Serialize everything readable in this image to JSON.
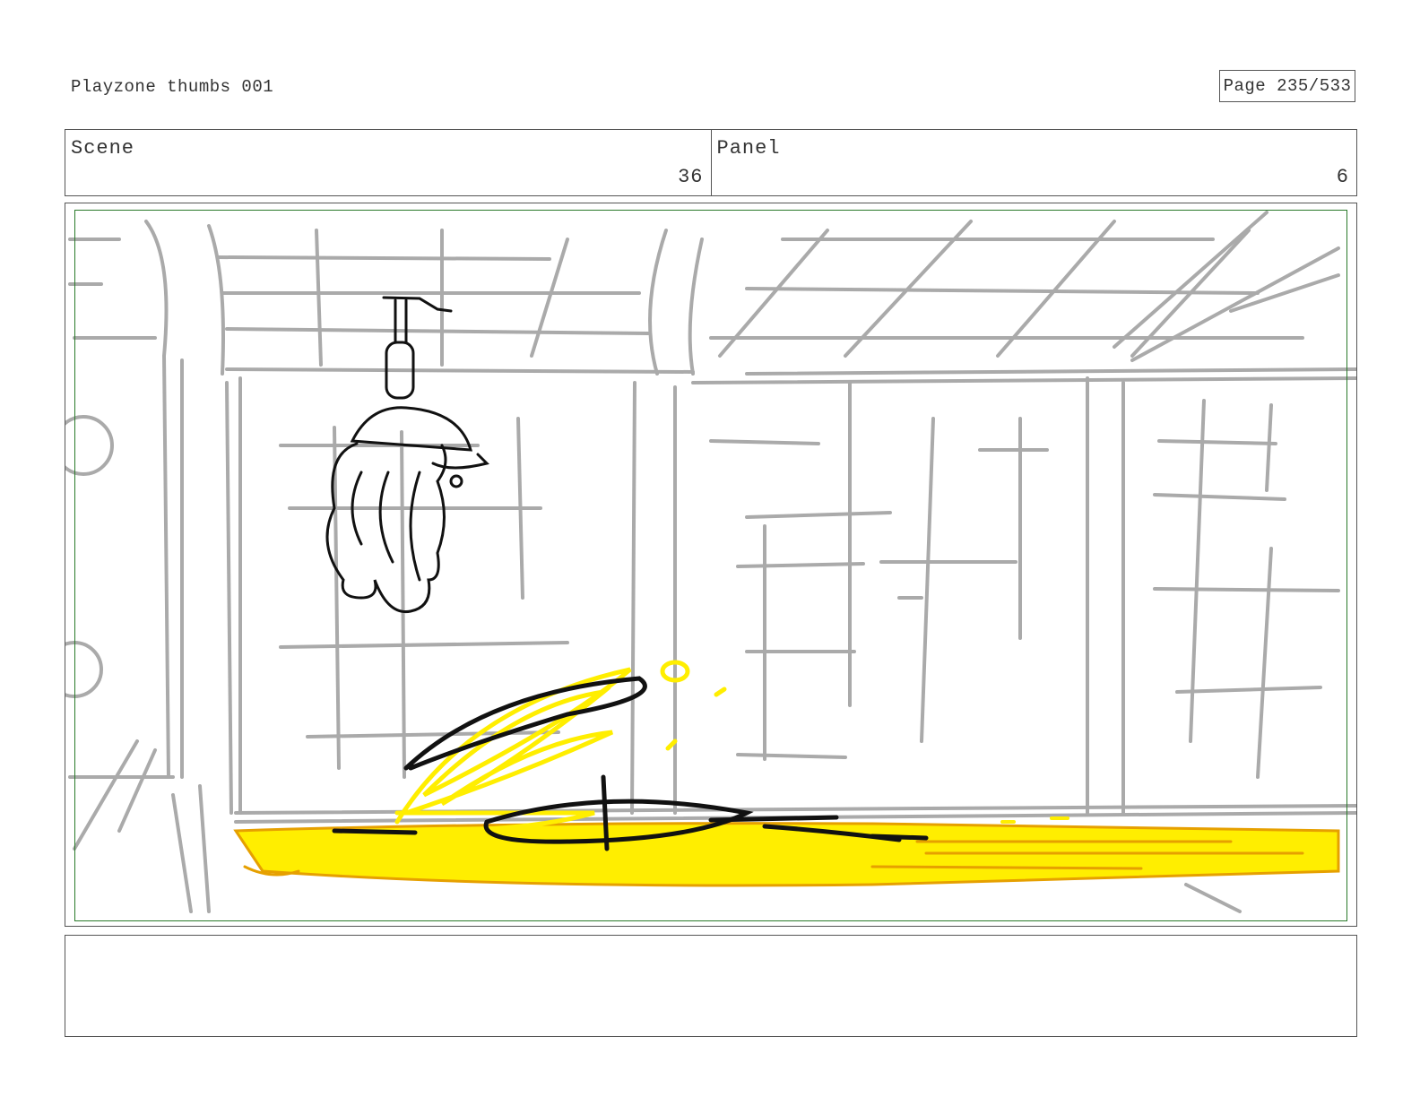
{
  "document": {
    "title": "Playzone thumbs 001",
    "page": "Page 235/533"
  },
  "header": {
    "scene_label": "Scene",
    "scene_value": "36",
    "panel_label": "Panel",
    "panel_value": "6"
  },
  "panel_image": {
    "colors": {
      "sketch_gray": "#aaaaaa",
      "ink": "#111111",
      "highlight_yellow": "#ffee00",
      "shadow_orange": "#e6a000",
      "safe_frame": "#2a7a2a"
    }
  },
  "notes": {
    "text": ""
  }
}
